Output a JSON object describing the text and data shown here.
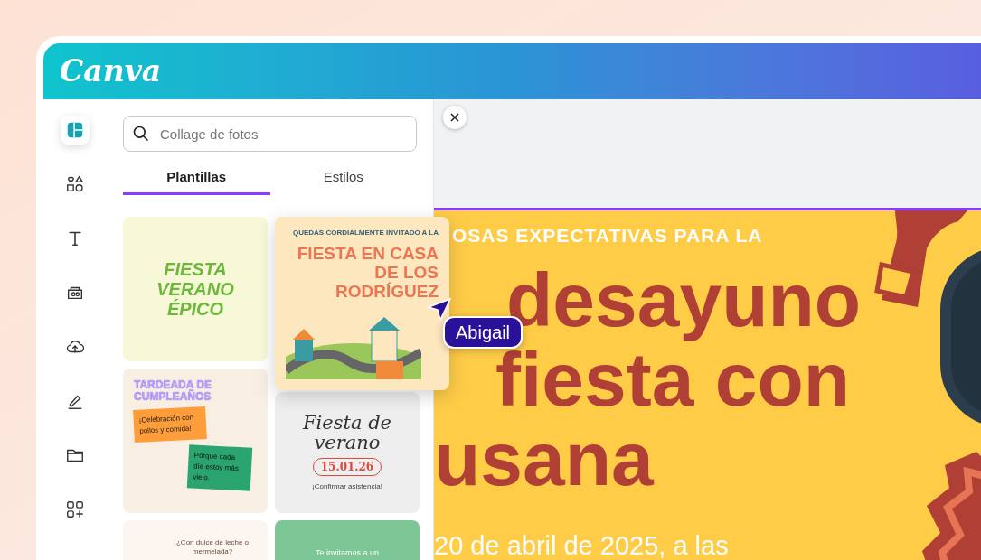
{
  "app": {
    "logo": "Canva"
  },
  "rail": [
    {
      "kind": "templates",
      "selected": true
    },
    {
      "kind": "elements",
      "selected": false
    },
    {
      "kind": "text",
      "selected": false
    },
    {
      "kind": "brand",
      "selected": false
    },
    {
      "kind": "uploads",
      "selected": false
    },
    {
      "kind": "draw",
      "selected": false
    },
    {
      "kind": "projects",
      "selected": false
    },
    {
      "kind": "apps",
      "selected": false
    }
  ],
  "search": {
    "placeholder": "Collage de fotos"
  },
  "tabs": [
    {
      "label": "Plantillas",
      "selected": true
    },
    {
      "label": "Estilos",
      "selected": false
    }
  ],
  "templates": [
    {
      "kind": "tropical",
      "lines": [
        "FIESTA VERANO ÉPICO"
      ]
    },
    {
      "kind": "houses",
      "lines": [
        "QUEDAS CORDIALMENTE INVITADO A LA",
        "FIESTA EN CASA DE LOS RODRÍGUEZ"
      ]
    },
    {
      "kind": "birthday",
      "lines": [
        "TARDEADA DE CUMPLEAÑOS",
        "¡Celebración con pollos y comida!",
        "Porque cada día estoy más viejo."
      ]
    },
    {
      "kind": "summer",
      "lines": [
        "Fiesta de verano",
        "15.01.26",
        "¡Confirmar asistencia!"
      ]
    },
    {
      "kind": "breakfast",
      "lines": [
        "¿Con dulce de leche o mermelada?"
      ]
    },
    {
      "kind": "green",
      "lines": [
        "Te invitamos a un"
      ]
    }
  ],
  "collaborator": {
    "name": "Abigail"
  },
  "canvas": {
    "kicker": "OSAS EXPECTATIVAS PARA LA",
    "headline": [
      "desayuno",
      "fiesta con",
      "usana"
    ],
    "date_line": "20 de abril de 2025, a las"
  }
}
